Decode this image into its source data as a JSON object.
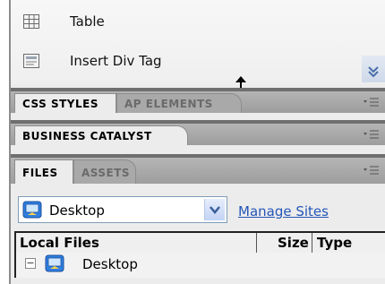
{
  "insert_panel": {
    "items": [
      {
        "label": "Table",
        "icon": "table-icon"
      },
      {
        "label": "Insert Div Tag",
        "icon": "div-tag-icon"
      }
    ]
  },
  "css_panel": {
    "tabs": [
      {
        "label": "CSS STYLES",
        "active": true
      },
      {
        "label": "AP ELEMENTS",
        "active": false
      }
    ]
  },
  "bc_panel": {
    "tabs": [
      {
        "label": "BUSINESS CATALYST",
        "active": true
      }
    ]
  },
  "files_panel": {
    "tabs": [
      {
        "label": "FILES",
        "active": true
      },
      {
        "label": "ASSETS",
        "active": false
      }
    ],
    "site_select": {
      "value": "Desktop",
      "icon": "desktop-icon"
    },
    "manage_sites_label": "Manage Sites",
    "columns": [
      "Local Files",
      "Size",
      "Type"
    ],
    "tree": [
      {
        "label": "Desktop",
        "expanded": true,
        "icon": "desktop-icon"
      }
    ]
  },
  "colors": {
    "link": "#2456b8",
    "panel_bg": "#ececec",
    "header_bg": "#a5a5a5"
  }
}
